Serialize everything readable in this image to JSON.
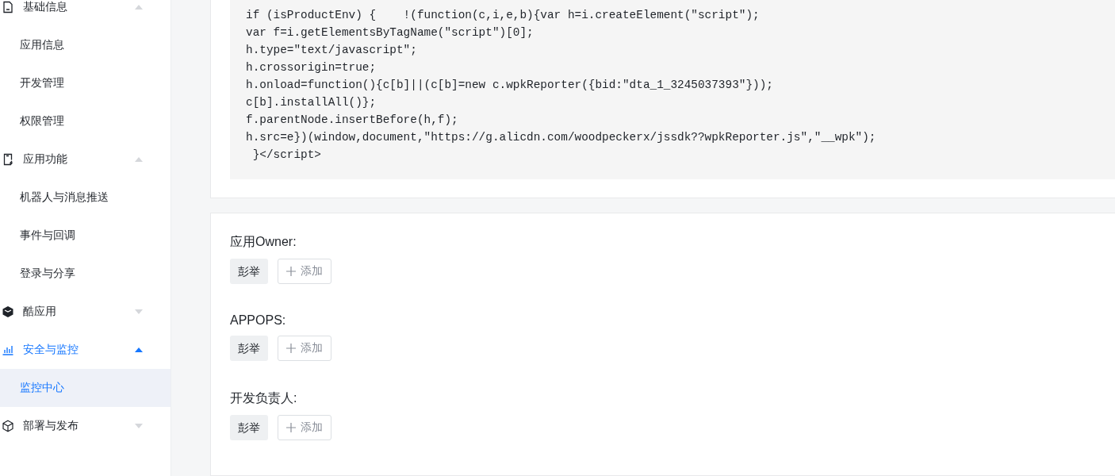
{
  "sidebar": {
    "groups": [
      {
        "label": "基础信息",
        "expanded": true,
        "selected": false,
        "children": [
          {
            "label": "应用信息",
            "selected": false
          },
          {
            "label": "开发管理",
            "selected": false
          },
          {
            "label": "权限管理",
            "selected": false
          }
        ]
      },
      {
        "label": "应用功能",
        "expanded": true,
        "selected": false,
        "children": [
          {
            "label": "机器人与消息推送",
            "selected": false
          },
          {
            "label": "事件与回调",
            "selected": false
          },
          {
            "label": "登录与分享",
            "selected": false
          }
        ]
      },
      {
        "label": "酷应用",
        "expanded": false,
        "selected": false
      },
      {
        "label": "安全与监控",
        "expanded": true,
        "selected": true,
        "children": [
          {
            "label": "监控中心",
            "selected": true
          }
        ]
      },
      {
        "label": "部署与发布",
        "expanded": false,
        "selected": false
      }
    ]
  },
  "code": {
    "lines": [
      "if (isProductEnv) {    !(function(c,i,e,b){var h=i.createElement(\"script\");",
      "var f=i.getElementsByTagName(\"script\")[0];",
      "h.type=\"text/javascript\";",
      "h.crossorigin=true;",
      "h.onload=function(){c[b]||(c[b]=new c.wpkReporter({bid:\"dta_1_3245037393\"}));",
      "c[b].installAll()};",
      "f.parentNode.insertBefore(h,f);",
      "h.src=e})(window,document,\"https://g.alicdn.com/woodpeckerx/jssdk??wpkReporter.js\",\"__wpk\");",
      " }</script>"
    ]
  },
  "roles": [
    {
      "label": "应用Owner:",
      "members": [
        "彭举"
      ],
      "add_label": "添加"
    },
    {
      "label": "APPOPS:",
      "members": [
        "彭举"
      ],
      "add_label": "添加"
    },
    {
      "label": "开发负责人:",
      "members": [
        "彭举"
      ],
      "add_label": "添加"
    }
  ]
}
